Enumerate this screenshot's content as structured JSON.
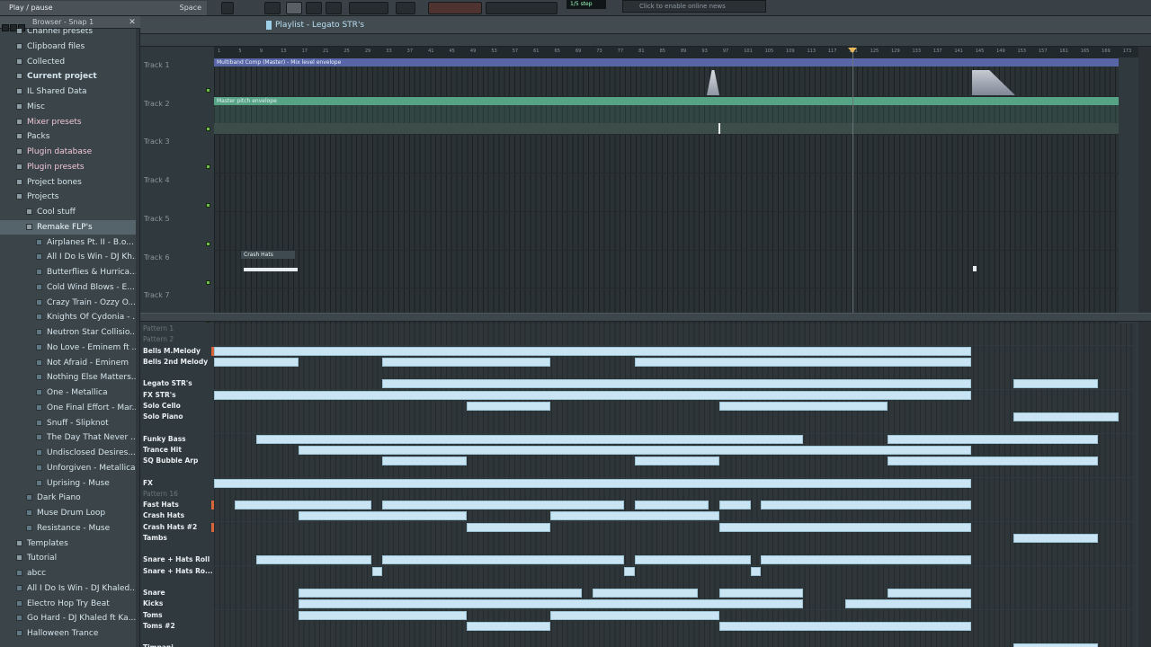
{
  "toolbar": {
    "hint_text": "Play / pause",
    "hint_key": "Space",
    "step_label": "1/5 step",
    "news_text": "Click to enable online news"
  },
  "browser": {
    "title": "Browser - Snap 1",
    "items": [
      {
        "label": "Channel presets",
        "kind": "folder",
        "indent": 0
      },
      {
        "label": "Clipboard files",
        "kind": "folder",
        "indent": 0
      },
      {
        "label": "Collected",
        "kind": "folder",
        "indent": 0
      },
      {
        "label": "Current project",
        "kind": "folder",
        "indent": 0,
        "bold": true
      },
      {
        "label": "IL Shared Data",
        "kind": "folder",
        "indent": 0
      },
      {
        "label": "Misc",
        "kind": "folder",
        "indent": 0
      },
      {
        "label": "Mixer presets",
        "kind": "folder",
        "indent": 0,
        "pink": true
      },
      {
        "label": "Packs",
        "kind": "folder",
        "indent": 0
      },
      {
        "label": "Plugin database",
        "kind": "folder",
        "indent": 0,
        "pink": true
      },
      {
        "label": "Plugin presets",
        "kind": "folder",
        "indent": 0,
        "pink": true
      },
      {
        "label": "Project bones",
        "kind": "folder",
        "indent": 0
      },
      {
        "label": "Projects",
        "kind": "folder",
        "indent": 0
      },
      {
        "label": "Cool stuff",
        "kind": "folder",
        "indent": 1
      },
      {
        "label": "Remake FLP's",
        "kind": "folder",
        "indent": 1,
        "selected": true
      },
      {
        "label": "Airplanes Pt. II - B.o...",
        "kind": "file",
        "indent": 2
      },
      {
        "label": "All I Do Is Win - DJ Kh...",
        "kind": "file",
        "indent": 2
      },
      {
        "label": "Butterflies & Hurrica...",
        "kind": "file",
        "indent": 2
      },
      {
        "label": "Cold Wind Blows - E...",
        "kind": "file",
        "indent": 2
      },
      {
        "label": "Crazy Train - Ozzy O...",
        "kind": "file",
        "indent": 2
      },
      {
        "label": "Knights Of Cydonia - ...",
        "kind": "file",
        "indent": 2
      },
      {
        "label": "Neutron Star Collisio...",
        "kind": "file",
        "indent": 2
      },
      {
        "label": "No Love - Eminem ft ...",
        "kind": "file",
        "indent": 2
      },
      {
        "label": "Not Afraid - Eminem",
        "kind": "file",
        "indent": 2
      },
      {
        "label": "Nothing Else Matters...",
        "kind": "file",
        "indent": 2
      },
      {
        "label": "One - Metallica",
        "kind": "file",
        "indent": 2
      },
      {
        "label": "One Final Effort - Mar...",
        "kind": "file",
        "indent": 2
      },
      {
        "label": "Snuff - Slipknot",
        "kind": "file",
        "indent": 2
      },
      {
        "label": "The Day That Never ...",
        "kind": "file",
        "indent": 2
      },
      {
        "label": "Undisclosed Desires...",
        "kind": "file",
        "indent": 2
      },
      {
        "label": "Unforgiven - Metallica",
        "kind": "file",
        "indent": 2
      },
      {
        "label": "Uprising - Muse",
        "kind": "file",
        "indent": 2
      },
      {
        "label": "Dark Piano",
        "kind": "file",
        "indent": 1
      },
      {
        "label": "Muse Drum Loop",
        "kind": "file",
        "indent": 1
      },
      {
        "label": "Resistance - Muse",
        "kind": "file",
        "indent": 1
      },
      {
        "label": "Templates",
        "kind": "folder",
        "indent": 0
      },
      {
        "label": "Tutorial",
        "kind": "folder",
        "indent": 0
      },
      {
        "label": "abcc",
        "kind": "file",
        "indent": 0
      },
      {
        "label": "All I Do Is Win - DJ Khaled...",
        "kind": "file",
        "indent": 0
      },
      {
        "label": "Electro Hop Try Beat",
        "kind": "file",
        "indent": 0
      },
      {
        "label": "Go Hard - DJ Khaled ft Ka...",
        "kind": "file",
        "indent": 0
      },
      {
        "label": "Halloween Trance",
        "kind": "file",
        "indent": 0
      }
    ]
  },
  "playlist": {
    "title": "Playlist - Legato STR's",
    "ruler_ticks": [
      "1",
      "5",
      "9",
      "13",
      "17",
      "21",
      "25",
      "29",
      "33",
      "37",
      "41",
      "45",
      "49",
      "53",
      "57",
      "61",
      "65",
      "69",
      "73",
      "77",
      "81",
      "85",
      "89",
      "93",
      "97",
      "101",
      "105",
      "109",
      "113",
      "117",
      "121",
      "125",
      "129",
      "133",
      "137",
      "141",
      "145",
      "149",
      "153",
      "157",
      "161",
      "165",
      "169",
      "173"
    ],
    "tracks": [
      {
        "label": "Track 1",
        "clip": "Multiband Comp (Master) - Mix level envelope"
      },
      {
        "label": "Track 2",
        "clip": "Master pitch envelope"
      },
      {
        "label": "Track 3",
        "clip": ""
      },
      {
        "label": "Track 4",
        "clip": ""
      },
      {
        "label": "Track 5",
        "clip": ""
      },
      {
        "label": "Track 6",
        "clip": "Crash Hats"
      },
      {
        "label": "Track 7",
        "clip": ""
      }
    ]
  },
  "patterns": {
    "rows": [
      {
        "label": "Pattern 1",
        "dim": true,
        "blocks": []
      },
      {
        "label": "Pattern 2",
        "dim": true,
        "blocks": []
      },
      {
        "label": "Bells M.Melody",
        "mark": true,
        "blocks": [
          [
            0,
            36
          ]
        ]
      },
      {
        "label": "Bells 2nd Melody",
        "blocks": [
          [
            0,
            4
          ],
          [
            8,
            16
          ],
          [
            20,
            36
          ]
        ]
      },
      {
        "label": "",
        "blocks": []
      },
      {
        "label": "Legato STR's",
        "blocks": [
          [
            8,
            36
          ],
          [
            38,
            42
          ]
        ]
      },
      {
        "label": "FX STR's",
        "blocks": [
          [
            0,
            36
          ]
        ]
      },
      {
        "label": "Solo Cello",
        "blocks": [
          [
            12,
            16
          ],
          [
            24,
            32
          ]
        ]
      },
      {
        "label": "Solo Piano",
        "blocks": [
          [
            38,
            43
          ]
        ]
      },
      {
        "label": "",
        "blocks": []
      },
      {
        "label": "Funky Bass",
        "blocks": [
          [
            2,
            28
          ],
          [
            32,
            42
          ]
        ]
      },
      {
        "label": "Trance Hit",
        "blocks": [
          [
            4,
            36
          ]
        ]
      },
      {
        "label": "SQ Bubble Arp",
        "blocks": [
          [
            8,
            12
          ],
          [
            20,
            24
          ],
          [
            32,
            42
          ]
        ]
      },
      {
        "label": "",
        "blocks": []
      },
      {
        "label": "FX",
        "blocks": [
          [
            0,
            36
          ]
        ]
      },
      {
        "label": "Pattern 16",
        "dim": true,
        "blocks": []
      },
      {
        "label": "Fast Hats",
        "mark": true,
        "blocks": [
          [
            1,
            7.5
          ],
          [
            8,
            19.5
          ],
          [
            20,
            23.5
          ],
          [
            24,
            25.5
          ],
          [
            26,
            36
          ]
        ]
      },
      {
        "label": "Crash Hats",
        "blocks": [
          [
            4,
            12
          ],
          [
            16,
            24
          ]
        ]
      },
      {
        "label": "Crash Hats #2",
        "mark": true,
        "blocks": [
          [
            12,
            16
          ],
          [
            24,
            36
          ]
        ]
      },
      {
        "label": "Tambs",
        "blocks": [
          [
            38,
            42
          ]
        ]
      },
      {
        "label": "",
        "blocks": []
      },
      {
        "label": "Snare + Hats Roll",
        "blocks": [
          [
            2,
            7.5
          ],
          [
            8,
            19.5
          ],
          [
            20,
            25.5
          ],
          [
            26,
            36
          ]
        ]
      },
      {
        "label": "Snare + Hats Ro...",
        "blocks": [
          [
            7.5,
            8
          ],
          [
            19.5,
            20
          ],
          [
            25.5,
            26
          ]
        ]
      },
      {
        "label": "",
        "blocks": []
      },
      {
        "label": "Snare",
        "blocks": [
          [
            4,
            17.5
          ],
          [
            18,
            23
          ],
          [
            24,
            28
          ],
          [
            32,
            36
          ]
        ]
      },
      {
        "label": "Kicks",
        "blocks": [
          [
            4,
            28
          ],
          [
            30,
            36
          ]
        ]
      },
      {
        "label": "Toms",
        "blocks": [
          [
            4,
            12
          ],
          [
            16,
            24
          ]
        ]
      },
      {
        "label": "Toms #2",
        "blocks": [
          [
            12,
            16
          ],
          [
            24,
            36
          ]
        ]
      },
      {
        "label": "",
        "blocks": []
      },
      {
        "label": "Timpani",
        "blocks": [
          [
            38,
            42
          ]
        ]
      }
    ]
  }
}
